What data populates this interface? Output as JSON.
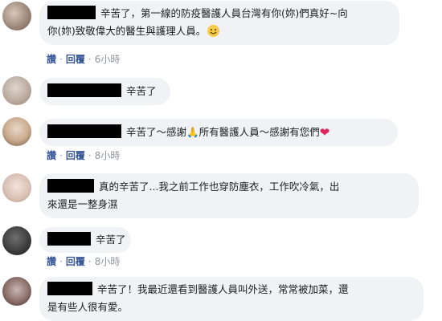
{
  "comments": [
    {
      "text_line1": "辛苦了，第一線的防疫醫護人員台灣有你(妳)們真好~向",
      "text_line2": "你(妳)致敬偉大的醫生與護理人員。",
      "emoji": "smiley-emoji",
      "actions": {
        "like": "讚",
        "reply": "回覆",
        "time": "6小時"
      }
    },
    {
      "text": "辛苦了"
    },
    {
      "text": "辛苦了～感謝",
      "emoji": "🙏",
      "text_after": "所有醫護人員～感謝有您們",
      "heart": "❤",
      "actions": {
        "like": "讚",
        "reply": "回覆",
        "time": "8小時"
      }
    },
    {
      "text_line1": "真的辛苦了...我之前工作也穿防塵衣，工作吹冷氣，出",
      "text_line2": "來還是一整身濕"
    },
    {
      "text": "辛苦了",
      "actions": {
        "like": "讚",
        "reply": "回覆",
        "time": "8小時"
      }
    },
    {
      "text_line1": "辛苦了！我最近還看到醫護人員叫外送，常常被加菜，還",
      "text_line2": "是有些人很有愛。"
    }
  ],
  "separator": "·",
  "colors": {
    "bubble": "#f0f2f5",
    "action_link": "#385898",
    "timestamp": "#90949c",
    "heart": "#e0245e",
    "redaction": "#000000"
  }
}
